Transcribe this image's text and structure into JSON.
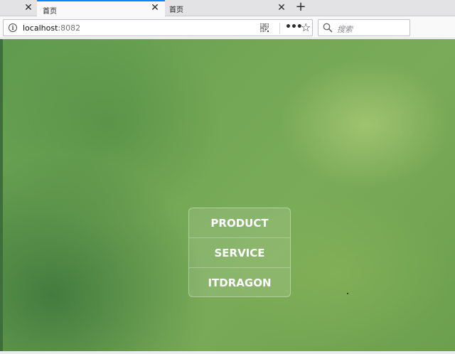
{
  "tabs": [
    {
      "label": "首页",
      "active": true
    },
    {
      "label": "首页",
      "active": false
    }
  ],
  "navbar": {
    "url_host": "localhost",
    "url_port": ":8082",
    "search_placeholder": "搜索"
  },
  "menu": {
    "items": [
      {
        "label": "PRODUCT"
      },
      {
        "label": "SERVICE"
      },
      {
        "label": "ITDRAGON"
      }
    ]
  },
  "colors": {
    "accent_tab": "#0a84ff",
    "background_green": "#73a755"
  },
  "icons": [
    "close-icon",
    "new-tab-icon",
    "info-icon",
    "qr-code-icon",
    "more-icon",
    "bookmark-star-icon",
    "search-icon"
  ]
}
